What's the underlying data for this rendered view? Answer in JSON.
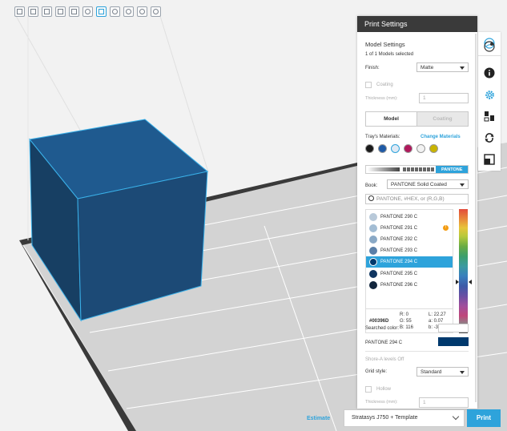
{
  "toolbar": {
    "icons": [
      "view-front-icon",
      "view-back-icon",
      "view-left-icon",
      "view-right-icon",
      "view-top-icon",
      "view-iso-icon",
      "grid-icon",
      "target-icon",
      "zoom-fit-icon",
      "zoom-region-icon",
      "zoom-icon"
    ]
  },
  "panel": {
    "title": "Print Settings",
    "model_settings_heading": "Model Settings",
    "selection_status": "1 of 1 Models selected",
    "finish_label": "Finish:",
    "finish_value": "Matte",
    "coating_label": "Coating",
    "thickness_label": "Thickness (mm):",
    "thickness_value": "1",
    "tabs": {
      "model": "Model",
      "coating": "Coating"
    },
    "trays_materials_label": "Tray's Materials:",
    "change_materials_link": "Change Materials",
    "tray_swatches": [
      "#1a1a1a",
      "#1f5aa6",
      "#dfe9f4",
      "#b0185c",
      "#e8e8e8",
      "#c9b400"
    ],
    "palette_tab_pantone": "PANTONE",
    "book_label": "Book:",
    "book_value": "PANTONE Solid Coated",
    "search_placeholder": "PANTONE, #HEX, or (R,G,B)",
    "colors": [
      {
        "name": "PANTONE 290 C",
        "color": "#b8c9d9"
      },
      {
        "name": "PANTONE 291 C",
        "color": "#a3bdd4"
      },
      {
        "name": "PANTONE 292 C",
        "color": "#8aa9c6"
      },
      {
        "name": "PANTONE 293 C",
        "color": "#5a7fa8"
      },
      {
        "name": "PANTONE 294 C",
        "color": "#00396d"
      },
      {
        "name": "PANTONE 295 C",
        "color": "#0f3560"
      },
      {
        "name": "PANTONE 296 C",
        "color": "#12263d"
      }
    ],
    "selected_color_index": 4,
    "values": {
      "hex": "#00396D",
      "r": "R: 0",
      "g": "G: 55",
      "b": "B: 116",
      "l": "L: 22.27",
      "a": "a: 0.07",
      "bb": "b: -37.28"
    },
    "searched_color_label": "Searched color:",
    "selected_name": "PANTONE 294 C",
    "selected_hex": "#00396d",
    "shore_label": "Shore-A levels Off",
    "grid_style_label": "Grid style:",
    "grid_style_value": "Standard",
    "hollow_label": "Hollow",
    "thickness2_label": "Thickness (mm):",
    "thickness2_value": "1"
  },
  "bottom": {
    "estimate_label": "Estimate",
    "printer_value": "Stratasys J750 + Template",
    "print_label": "Print"
  },
  "colors": {
    "accent": "#2ea3db",
    "cube": "#1f4e79"
  }
}
